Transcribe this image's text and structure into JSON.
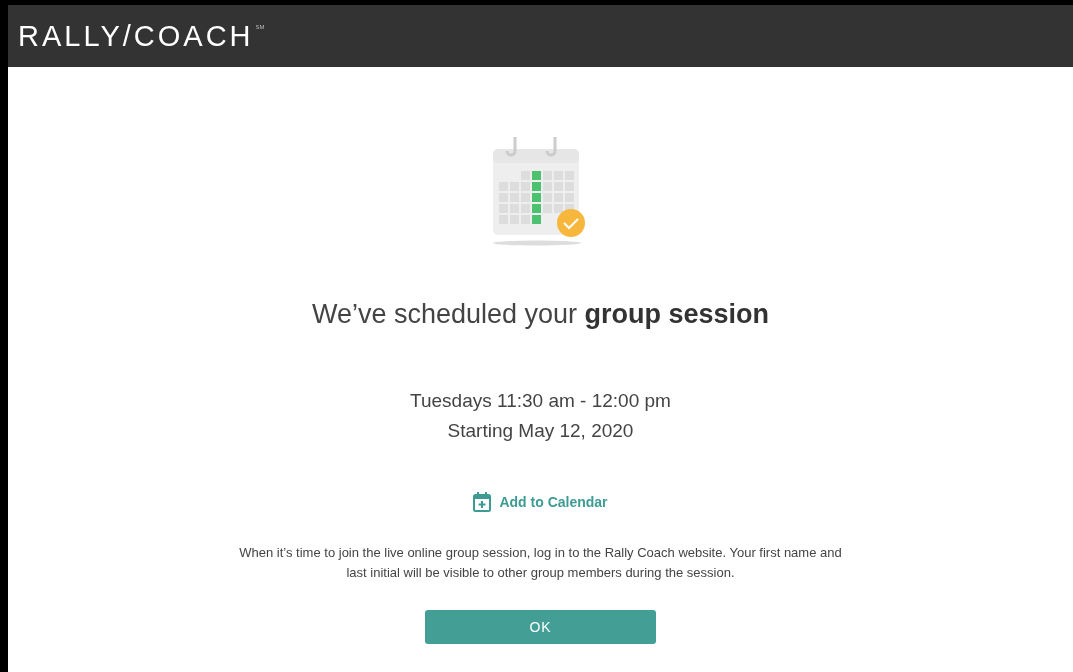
{
  "header": {
    "logo": "RALLY/COACH",
    "service_mark": "SM"
  },
  "confirmation": {
    "title": "We’ve scheduled your **group session**",
    "schedule": "Tuesdays 11:30 am - 12:00 pm",
    "start": "Starting May 12, 2020",
    "add_to_calendar": "Add to Calendar",
    "note": "When it’s time to join the live online group session, log in to the Rally Coach website. Your first name and last initial will be visible to other group members during the session.",
    "button": "OK"
  }
}
